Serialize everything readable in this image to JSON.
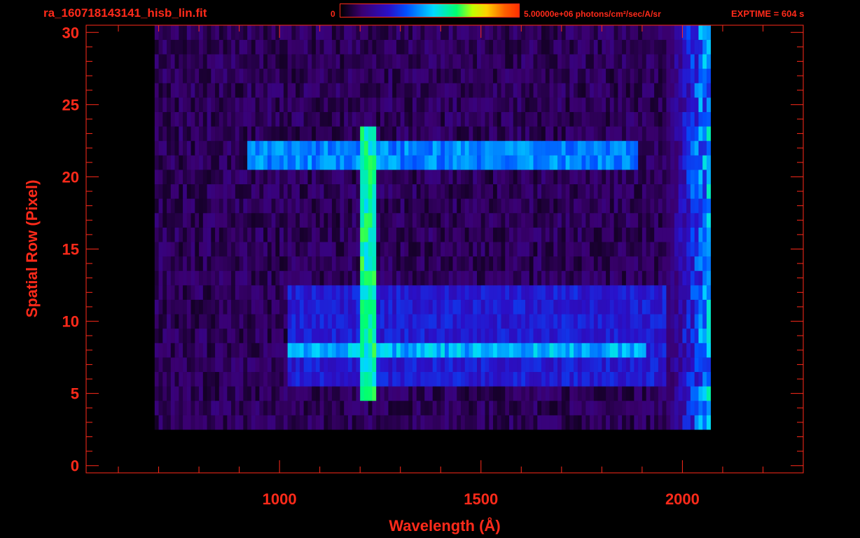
{
  "header": {
    "file_name": "ra_160718143141_hisb_lin.fit",
    "colorbar_min": "0",
    "colorbar_max": "5.00000e+06 photons/cm²/sec/A/sr",
    "exptime": "EXPTIME = 604 s"
  },
  "colors": {
    "text": "#ff2a1a",
    "background": "#000000"
  },
  "chart_data": {
    "type": "heatmap",
    "title": "ra_160718143141_hisb_lin.fit",
    "xlabel": "Wavelength (Å)",
    "ylabel": "Spatial Row (Pixel)",
    "xlim": [
      520,
      2300
    ],
    "ylim": [
      -0.5,
      30.5
    ],
    "x_ticks": [
      1000,
      1500,
      2000
    ],
    "y_ticks": [
      0,
      5,
      10,
      15,
      20,
      25,
      30
    ],
    "colorbar": {
      "min": 0,
      "max": 5000000,
      "units": "photons/cm²/sec/A/sr"
    },
    "background_region": {
      "x": [
        690,
        2070
      ],
      "rows": [
        3,
        30
      ],
      "level": 0.12
    },
    "features": [
      {
        "name": "Lyman-alpha line",
        "wavelength": 1216,
        "rows": [
          5,
          23
        ],
        "level": 0.6
      },
      {
        "name": "bright row band",
        "rows": [
          21,
          22
        ],
        "x": [
          920,
          1880
        ],
        "level": 0.45
      },
      {
        "name": "bright row band",
        "rows": [
          8,
          8.9
        ],
        "x": [
          1020,
          1900
        ],
        "level": 0.5
      },
      {
        "name": "moderate row band",
        "rows": [
          6,
          12
        ],
        "x": [
          1020,
          1950
        ],
        "level": 0.3
      },
      {
        "name": "red-edge ramp",
        "x": [
          1930,
          2070
        ],
        "rows": [
          0,
          30
        ],
        "level": 0.55
      }
    ]
  }
}
